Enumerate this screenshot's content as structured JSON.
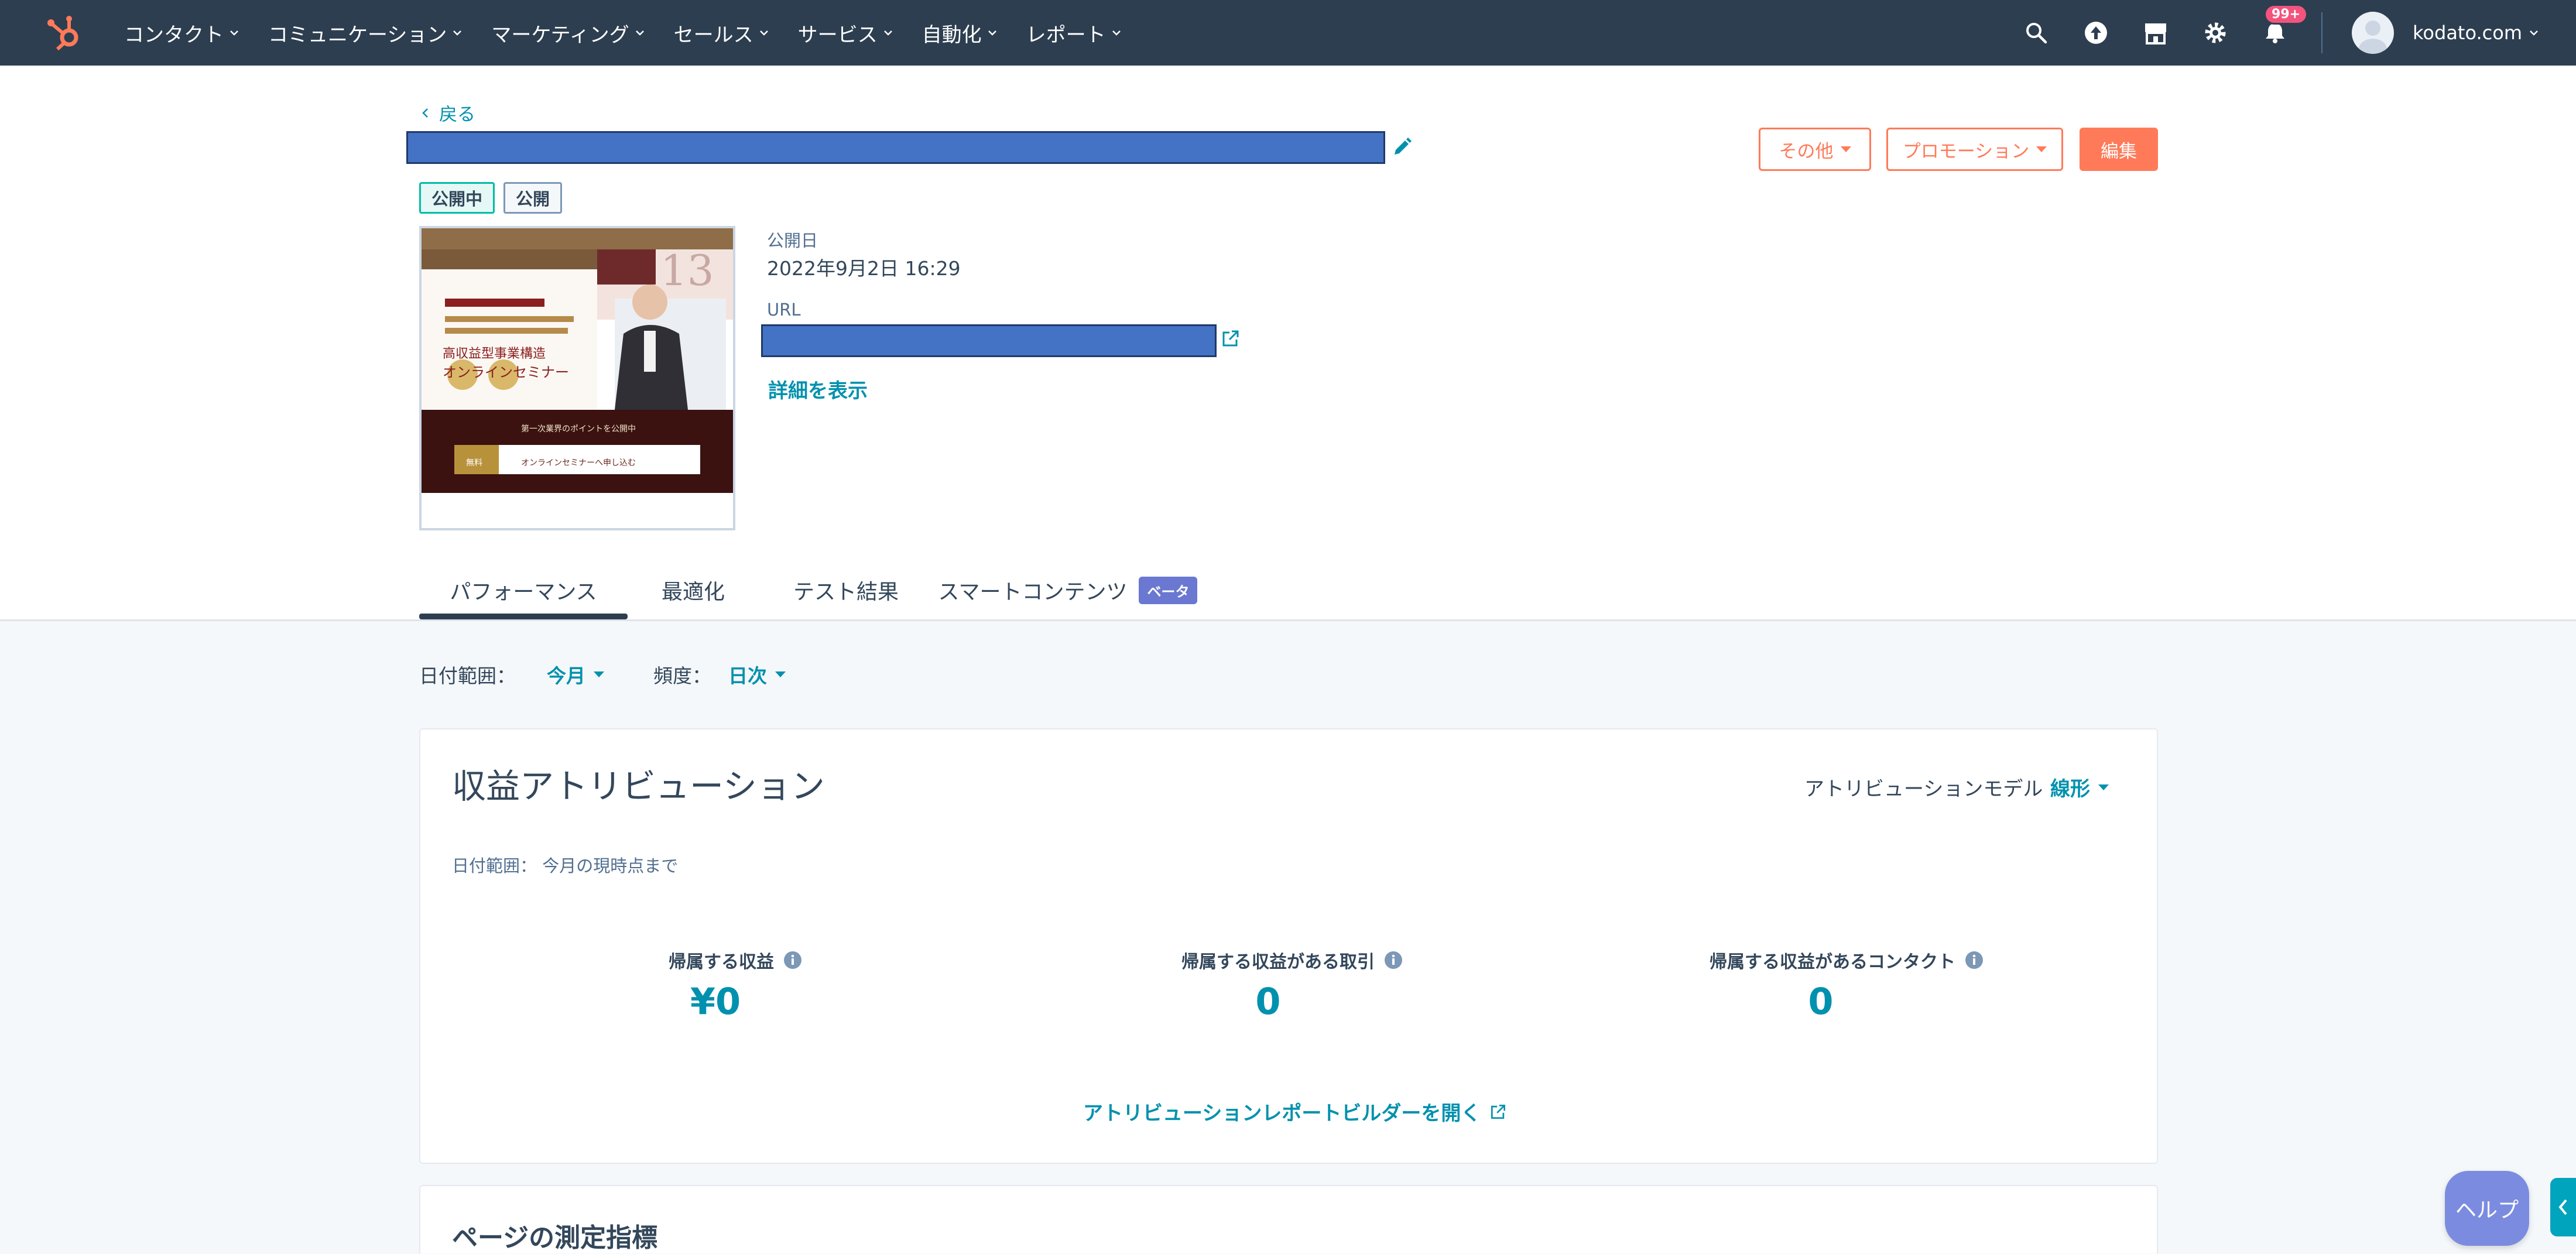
{
  "nav": {
    "items": [
      "コンタクト",
      "コミュニケーション",
      "マーケティング",
      "セールス",
      "サービス",
      "自動化",
      "レポート"
    ],
    "notification_badge": "99+",
    "account_name": "kodato.com"
  },
  "page": {
    "back_label": "戻る",
    "status_live": "公開中",
    "status_public": "公開",
    "buttons": {
      "more": "その他",
      "promotion": "プロモーション",
      "edit": "編集"
    },
    "meta": {
      "publish_label": "公開日",
      "publish_value": "2022年9月2日 16:29",
      "url_label": "URL",
      "details_link": "詳細を表示"
    },
    "thumbnail": {
      "date_number": "13",
      "heading_line1": "高収益型事業構造",
      "heading_line2": "オンラインセミナー",
      "banner_text": "第一次業界のポイントを公開中",
      "cta_tag": "無料",
      "cta_text": "オンラインセミナーへ申し込む"
    }
  },
  "tabs": [
    {
      "label": "パフォーマンス",
      "active": true
    },
    {
      "label": "最適化",
      "active": false
    },
    {
      "label": "テスト結果",
      "active": false
    },
    {
      "label": "スマートコンテンツ",
      "active": false,
      "badge": "ベータ"
    }
  ],
  "filters": {
    "date_range_label": "日付範囲：",
    "date_range_value": "今月",
    "frequency_label": "頻度：",
    "frequency_value": "日次"
  },
  "revenue_card": {
    "title": "収益アトリビューション",
    "date_note": "日付範囲： 今月の現時点まで",
    "model_label": "アトリビューションモデル",
    "model_value": "線形",
    "stats": [
      {
        "label": "帰属する収益",
        "value": "¥0"
      },
      {
        "label": "帰属する収益がある取引",
        "value": "0"
      },
      {
        "label": "帰属する収益があるコンタクト",
        "value": "0"
      }
    ],
    "report_link": "アトリビューションレポートビルダーを開く"
  },
  "metrics_card": {
    "title": "ページの測定指標"
  },
  "help_label": "ヘルプ",
  "colors": {
    "nav_bg": "#2d3e50",
    "accent_orange": "#ff7a59",
    "link_teal": "#0091ae",
    "beta_purple": "#6a78d1",
    "redaction_blue": "#4472c4"
  }
}
